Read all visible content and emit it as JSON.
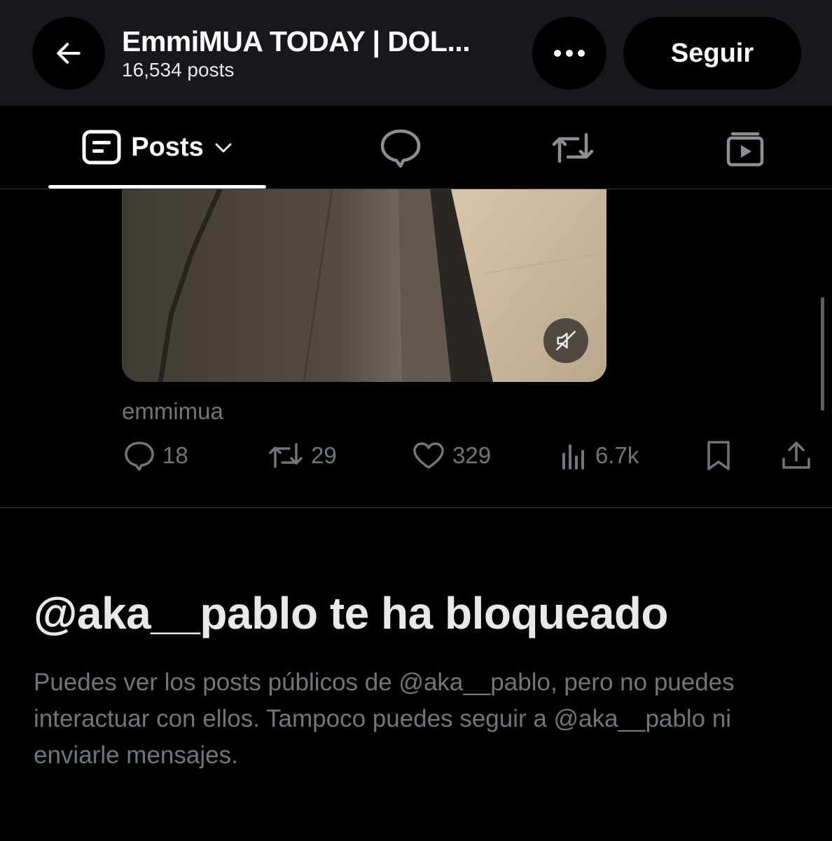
{
  "header": {
    "title": "EmmiMUA TODAY | DOL...",
    "post_count": "16,534 posts",
    "follow_label": "Seguir",
    "back_icon": "arrow-left-icon",
    "more_icon": "more-dots-icon"
  },
  "tabs": {
    "posts_label": "Posts",
    "items": [
      {
        "name": "posts",
        "icon": "post-list-icon",
        "active": true
      },
      {
        "name": "replies",
        "icon": "speech-bubble-icon"
      },
      {
        "name": "reposts",
        "icon": "repost-icon"
      },
      {
        "name": "media",
        "icon": "video-stack-icon"
      }
    ]
  },
  "post": {
    "handle": "emmimua",
    "mute_icon": "speaker-muted-icon",
    "stats": {
      "replies": "18",
      "reposts": "29",
      "likes": "329",
      "views": "6.7k"
    }
  },
  "blocked": {
    "title": "@aka__pablo te ha bloqueado",
    "description": "Puedes ver los posts públicos de @aka__pablo, pero no puedes interactuar con ellos. Tampoco puedes seguir a @aka__pablo ni enviarle mensajes."
  },
  "colors": {
    "background": "#000000",
    "header_bg": "#16181c",
    "text_primary": "#e7e9ea",
    "text_secondary": "#71767b",
    "divider": "#2f3336"
  }
}
